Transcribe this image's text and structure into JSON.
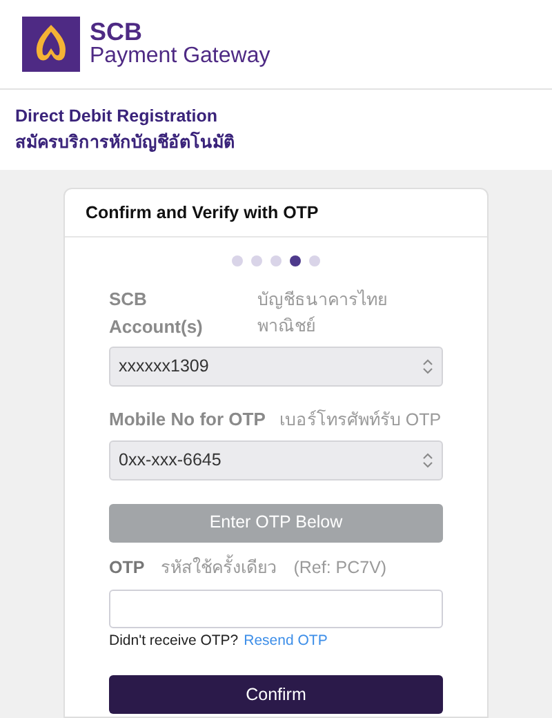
{
  "brand": {
    "name": "SCB",
    "subtitle": "Payment Gateway"
  },
  "page": {
    "title": "Direct Debit Registration",
    "title_thai": "สมัครบริการหักบัญชีอัตโนมัติ"
  },
  "card": {
    "title": "Confirm and Verify with OTP",
    "steps": [
      {
        "selected": false
      },
      {
        "selected": false
      },
      {
        "selected": false
      },
      {
        "selected": true
      },
      {
        "selected": false
      }
    ],
    "account": {
      "label": "SCB Account(s)",
      "label_thai": "บัญชีธนาคารไทยพาณิชย์",
      "value": "xxxxxx1309"
    },
    "mobile": {
      "label": "Mobile No for OTP",
      "label_thai": "เบอร์โทรศัพท์รับ OTP",
      "value": "0xx-xxx-6645"
    },
    "otp_button": {
      "label": "Enter OTP Below",
      "disabled": true
    },
    "otp": {
      "label": "OTP",
      "label_thai": "รหัสใช้ครั้งเดียว",
      "ref": "(Ref: PC7V)"
    },
    "resend": {
      "text": "Didn't receive OTP?",
      "link": "Resend OTP"
    },
    "confirm": "Confirm"
  }
}
